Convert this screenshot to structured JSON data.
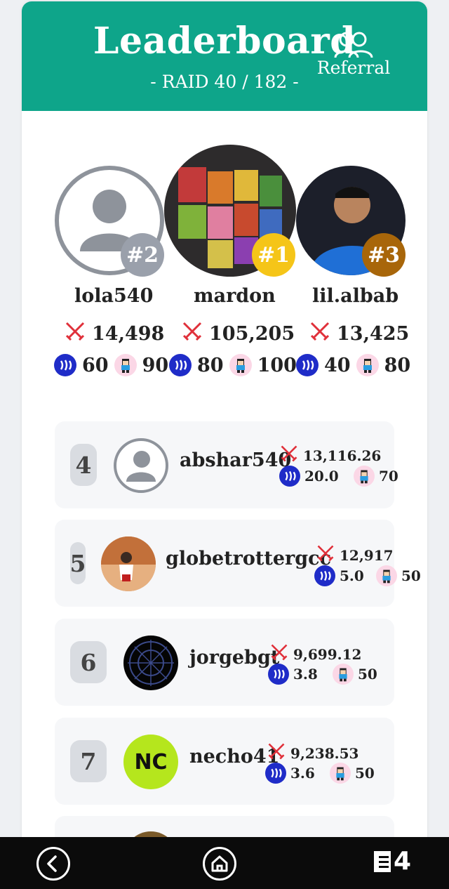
{
  "header": {
    "title": "Leaderboard",
    "subtitle": "- RAID 40 / 182 -",
    "referral_label": "Referral"
  },
  "podium": [
    {
      "badge": "#2",
      "name": "lola540",
      "damage": "14,498",
      "steem": "60",
      "tickets": "90",
      "badge_color": "#9aa0ab"
    },
    {
      "badge": "#1",
      "name": "mardon",
      "damage": "105,205",
      "steem": "80",
      "tickets": "100",
      "badge_color": "#f5c518"
    },
    {
      "badge": "#3",
      "name": "lil.albab",
      "damage": "13,425",
      "steem": "40",
      "tickets": "80",
      "badge_color": "#a8660a"
    }
  ],
  "rows": [
    {
      "rank": "4",
      "name": "abshar540",
      "damage": "13,116.26",
      "steem": "20.0",
      "tickets": "70"
    },
    {
      "rank": "5",
      "name": "globetrottergcc",
      "damage": "12,917",
      "steem": "5.0",
      "tickets": "50"
    },
    {
      "rank": "6",
      "name": "jorgebgt",
      "damage": "9,699.12",
      "steem": "3.8",
      "tickets": "50"
    },
    {
      "rank": "7",
      "name": "necho41",
      "damage": "9,238.53",
      "steem": "3.6",
      "tickets": "50",
      "avatar_text": "NC"
    }
  ],
  "bottom_nav": {
    "right_label": "4"
  },
  "colors": {
    "accent": "#0ea58a",
    "steem": "#1f2cc8",
    "sword": "#e0303a"
  }
}
